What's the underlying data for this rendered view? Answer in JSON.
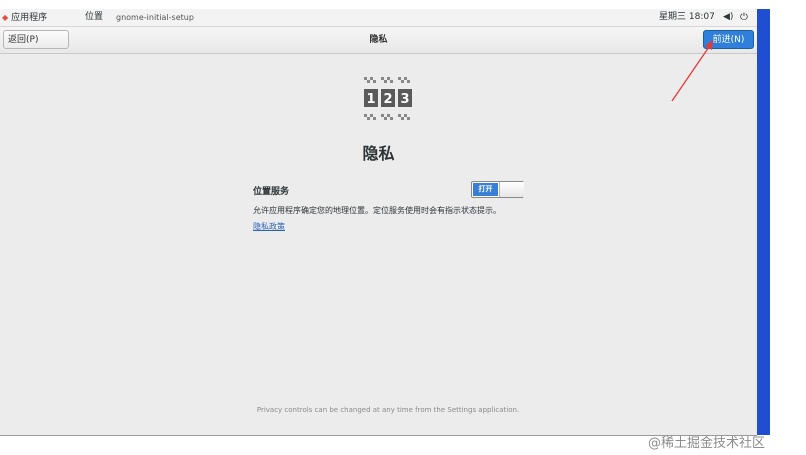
{
  "topbar": {
    "apps_label": "应用程序",
    "places_label": "位置",
    "app_name": "gnome-initial-setup",
    "clock": "星期三 18:07",
    "sound_icon": "speaker-icon",
    "power_icon": "power-icon"
  },
  "header": {
    "back_label": "返回(P)",
    "title": "隐私",
    "next_label": "前进(N)"
  },
  "main": {
    "icon": "privacy-123-icon",
    "icon_digits": [
      "1",
      "2",
      "3"
    ],
    "title": "隐私",
    "location_label": "位置服务",
    "toggle_on_label": "打开",
    "toggle_state": true,
    "description": "允许应用程序确定您的地理位置。定位服务使用时会有指示状态提示。",
    "policy_link": "隐私政策",
    "footer": "Privacy controls can be changed at any time from the Settings application."
  },
  "watermark": "@稀土掘金技术社区",
  "colors": {
    "accent": "#2f7fdb",
    "annotation": "#e53935",
    "side_bar": "#1f4fd0"
  }
}
